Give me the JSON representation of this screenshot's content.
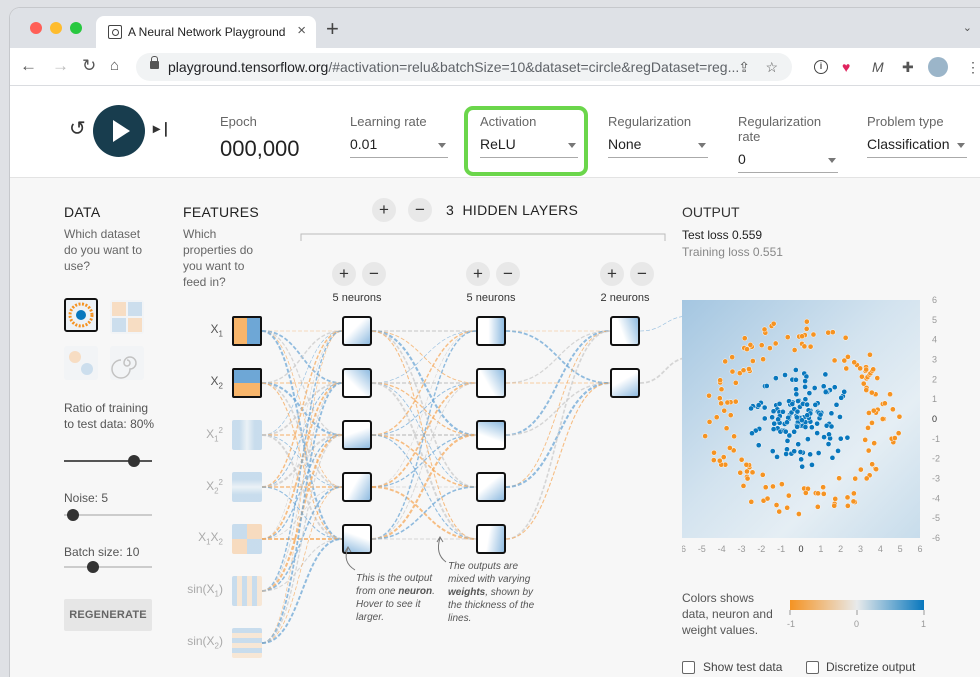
{
  "browser": {
    "tab_title": "A Neural Network Playground",
    "new_tab": "+",
    "url_host": "playground.tensorflow.org",
    "url_path": "/#activation=relu&batchSize=10&dataset=circle&regDataset=reg...",
    "traffic": [
      "#ff5f57",
      "#febc2e",
      "#28c840"
    ]
  },
  "controls": {
    "epoch_label": "Epoch",
    "epoch_value": "000,000",
    "learning_rate_label": "Learning rate",
    "learning_rate": "0.01",
    "activation_label": "Activation",
    "activation": "ReLU",
    "regularization_label": "Regularization",
    "regularization": "None",
    "reg_rate_label": "Regularization rate",
    "reg_rate": "0",
    "problem_label": "Problem type",
    "problem": "Classification"
  },
  "data_panel": {
    "title": "DATA",
    "question": "Which dataset do you want to use?",
    "ratio_label": "Ratio of training to test data:",
    "ratio_value": "80%",
    "ratio_fraction": 0.8,
    "noise_label": "Noise:",
    "noise_value": "5",
    "noise_fraction": 0.1,
    "batch_label": "Batch size:",
    "batch_value": "10",
    "batch_fraction": 0.333,
    "regenerate": "REGENERATE"
  },
  "features_panel": {
    "title": "FEATURES",
    "question": "Which properties do you want to feed in?",
    "features": [
      {
        "base": "X",
        "sub": "1",
        "sup": "",
        "active": true
      },
      {
        "base": "X",
        "sub": "2",
        "sup": "",
        "active": true
      },
      {
        "base": "X",
        "sub": "1",
        "sup": "2",
        "active": false
      },
      {
        "base": "X",
        "sub": "2",
        "sup": "2",
        "active": false
      },
      {
        "base": "X",
        "sub": "1",
        "sup": "",
        "base2": "X",
        "sub2": "2",
        "active": false
      },
      {
        "base": "sin(X",
        "sub": "1",
        "sup": "",
        "tail": ")",
        "active": false
      },
      {
        "base": "sin(X",
        "sub": "2",
        "sup": "",
        "tail": ")",
        "active": false
      }
    ]
  },
  "network": {
    "layers_count": "3",
    "layers_label": "HIDDEN LAYERS",
    "plus": "+",
    "minus": "−",
    "layers": [
      {
        "neurons_label": "5 neurons"
      },
      {
        "neurons_label": "5 neurons"
      },
      {
        "neurons_label": "2 neurons"
      }
    ],
    "note1_a": "This is the output from one ",
    "note1_b": "neuron",
    "note1_c": ". Hover to see it larger.",
    "note2_a": "The outputs are mixed with varying ",
    "note2_b": "weights",
    "note2_c": ", shown by the thickness of the lines."
  },
  "output_panel": {
    "title": "OUTPUT",
    "test_loss": "Test loss 0.559",
    "training_loss": "Training loss 0.551",
    "x_ticks": [
      "-6",
      "-5",
      "-4",
      "-3",
      "-2",
      "-1",
      "0",
      "1",
      "2",
      "3",
      "4",
      "5",
      "6"
    ],
    "y_ticks": [
      "6",
      "5",
      "4",
      "3",
      "2",
      "1",
      "0",
      "-1",
      "-2",
      "-3",
      "-4",
      "-5",
      "-6"
    ],
    "colors_label": "Colors shows data, neuron and weight values.",
    "scale_ticks": [
      "-1",
      "0",
      "1"
    ],
    "show_test": "Show test data",
    "discretize": "Discretize output",
    "orange": "#f59322",
    "blue": "#0877bd"
  }
}
